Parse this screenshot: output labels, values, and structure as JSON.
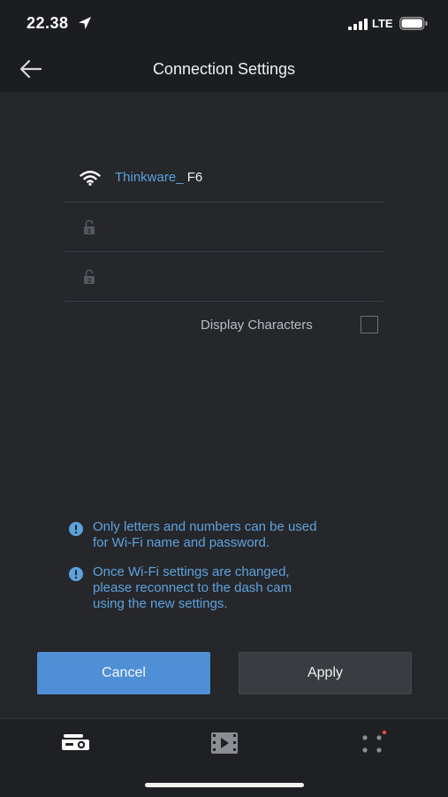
{
  "status_bar": {
    "time": "22.38",
    "network": "LTE",
    "icons": [
      "location-arrow-icon",
      "signal-bars-icon",
      "battery-icon"
    ]
  },
  "header": {
    "title": "Connection Settings",
    "back_icon": "arrow-left-icon"
  },
  "form": {
    "ssid": {
      "prefix": "Thinkware_",
      "suffix": " F6",
      "icon": "wifi-icon"
    },
    "password1": {
      "icon": "lock-1-icon",
      "value": "",
      "placeholder": ""
    },
    "password2": {
      "icon": "lock-2-icon",
      "value": "",
      "placeholder": ""
    },
    "display_characters": {
      "label": "Display Characters",
      "checked": false
    }
  },
  "notes": [
    {
      "icon": "info-icon",
      "text": "Only letters and numbers can be used\nfor Wi-Fi name and password."
    },
    {
      "icon": "info-icon",
      "text": "Once Wi-Fi settings are changed,\nplease reconnect to the dash cam\nusing the new settings."
    }
  ],
  "buttons": {
    "cancel": "Cancel",
    "apply": "Apply"
  },
  "tab_bar": {
    "items": [
      {
        "icon": "dashcam-icon",
        "active": true
      },
      {
        "icon": "video-film-icon",
        "active": false
      },
      {
        "icon": "more-dots-icon",
        "active": false,
        "badge": true
      }
    ]
  },
  "colors": {
    "accent": "#4f8fd5",
    "info_text": "#5ea2dd",
    "background": "#25272b",
    "header": "#1c1d21",
    "badge": "#e0503c"
  }
}
